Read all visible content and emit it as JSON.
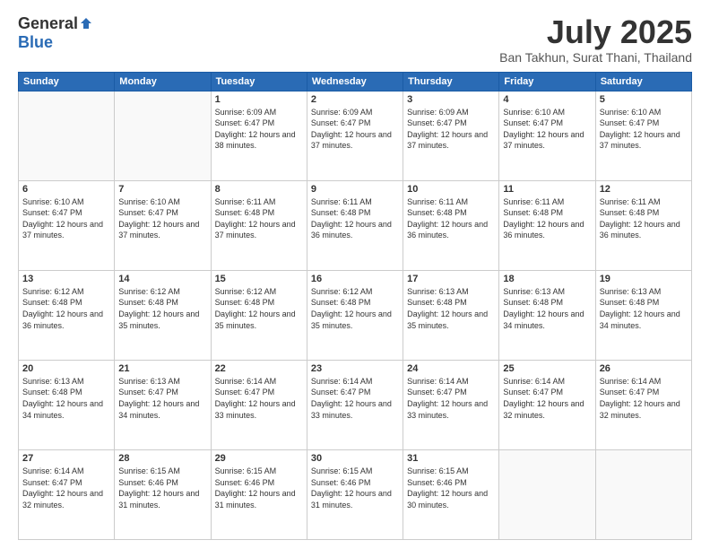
{
  "header": {
    "logo_general": "General",
    "logo_blue": "Blue",
    "month_title": "July 2025",
    "subtitle": "Ban Takhun, Surat Thani, Thailand"
  },
  "weekdays": [
    "Sunday",
    "Monday",
    "Tuesday",
    "Wednesday",
    "Thursday",
    "Friday",
    "Saturday"
  ],
  "weeks": [
    [
      {
        "day": "",
        "sunrise": "",
        "sunset": "",
        "daylight": ""
      },
      {
        "day": "",
        "sunrise": "",
        "sunset": "",
        "daylight": ""
      },
      {
        "day": "1",
        "sunrise": "Sunrise: 6:09 AM",
        "sunset": "Sunset: 6:47 PM",
        "daylight": "Daylight: 12 hours and 38 minutes."
      },
      {
        "day": "2",
        "sunrise": "Sunrise: 6:09 AM",
        "sunset": "Sunset: 6:47 PM",
        "daylight": "Daylight: 12 hours and 37 minutes."
      },
      {
        "day": "3",
        "sunrise": "Sunrise: 6:09 AM",
        "sunset": "Sunset: 6:47 PM",
        "daylight": "Daylight: 12 hours and 37 minutes."
      },
      {
        "day": "4",
        "sunrise": "Sunrise: 6:10 AM",
        "sunset": "Sunset: 6:47 PM",
        "daylight": "Daylight: 12 hours and 37 minutes."
      },
      {
        "day": "5",
        "sunrise": "Sunrise: 6:10 AM",
        "sunset": "Sunset: 6:47 PM",
        "daylight": "Daylight: 12 hours and 37 minutes."
      }
    ],
    [
      {
        "day": "6",
        "sunrise": "Sunrise: 6:10 AM",
        "sunset": "Sunset: 6:47 PM",
        "daylight": "Daylight: 12 hours and 37 minutes."
      },
      {
        "day": "7",
        "sunrise": "Sunrise: 6:10 AM",
        "sunset": "Sunset: 6:47 PM",
        "daylight": "Daylight: 12 hours and 37 minutes."
      },
      {
        "day": "8",
        "sunrise": "Sunrise: 6:11 AM",
        "sunset": "Sunset: 6:48 PM",
        "daylight": "Daylight: 12 hours and 37 minutes."
      },
      {
        "day": "9",
        "sunrise": "Sunrise: 6:11 AM",
        "sunset": "Sunset: 6:48 PM",
        "daylight": "Daylight: 12 hours and 36 minutes."
      },
      {
        "day": "10",
        "sunrise": "Sunrise: 6:11 AM",
        "sunset": "Sunset: 6:48 PM",
        "daylight": "Daylight: 12 hours and 36 minutes."
      },
      {
        "day": "11",
        "sunrise": "Sunrise: 6:11 AM",
        "sunset": "Sunset: 6:48 PM",
        "daylight": "Daylight: 12 hours and 36 minutes."
      },
      {
        "day": "12",
        "sunrise": "Sunrise: 6:11 AM",
        "sunset": "Sunset: 6:48 PM",
        "daylight": "Daylight: 12 hours and 36 minutes."
      }
    ],
    [
      {
        "day": "13",
        "sunrise": "Sunrise: 6:12 AM",
        "sunset": "Sunset: 6:48 PM",
        "daylight": "Daylight: 12 hours and 36 minutes."
      },
      {
        "day": "14",
        "sunrise": "Sunrise: 6:12 AM",
        "sunset": "Sunset: 6:48 PM",
        "daylight": "Daylight: 12 hours and 35 minutes."
      },
      {
        "day": "15",
        "sunrise": "Sunrise: 6:12 AM",
        "sunset": "Sunset: 6:48 PM",
        "daylight": "Daylight: 12 hours and 35 minutes."
      },
      {
        "day": "16",
        "sunrise": "Sunrise: 6:12 AM",
        "sunset": "Sunset: 6:48 PM",
        "daylight": "Daylight: 12 hours and 35 minutes."
      },
      {
        "day": "17",
        "sunrise": "Sunrise: 6:13 AM",
        "sunset": "Sunset: 6:48 PM",
        "daylight": "Daylight: 12 hours and 35 minutes."
      },
      {
        "day": "18",
        "sunrise": "Sunrise: 6:13 AM",
        "sunset": "Sunset: 6:48 PM",
        "daylight": "Daylight: 12 hours and 34 minutes."
      },
      {
        "day": "19",
        "sunrise": "Sunrise: 6:13 AM",
        "sunset": "Sunset: 6:48 PM",
        "daylight": "Daylight: 12 hours and 34 minutes."
      }
    ],
    [
      {
        "day": "20",
        "sunrise": "Sunrise: 6:13 AM",
        "sunset": "Sunset: 6:48 PM",
        "daylight": "Daylight: 12 hours and 34 minutes."
      },
      {
        "day": "21",
        "sunrise": "Sunrise: 6:13 AM",
        "sunset": "Sunset: 6:47 PM",
        "daylight": "Daylight: 12 hours and 34 minutes."
      },
      {
        "day": "22",
        "sunrise": "Sunrise: 6:14 AM",
        "sunset": "Sunset: 6:47 PM",
        "daylight": "Daylight: 12 hours and 33 minutes."
      },
      {
        "day": "23",
        "sunrise": "Sunrise: 6:14 AM",
        "sunset": "Sunset: 6:47 PM",
        "daylight": "Daylight: 12 hours and 33 minutes."
      },
      {
        "day": "24",
        "sunrise": "Sunrise: 6:14 AM",
        "sunset": "Sunset: 6:47 PM",
        "daylight": "Daylight: 12 hours and 33 minutes."
      },
      {
        "day": "25",
        "sunrise": "Sunrise: 6:14 AM",
        "sunset": "Sunset: 6:47 PM",
        "daylight": "Daylight: 12 hours and 32 minutes."
      },
      {
        "day": "26",
        "sunrise": "Sunrise: 6:14 AM",
        "sunset": "Sunset: 6:47 PM",
        "daylight": "Daylight: 12 hours and 32 minutes."
      }
    ],
    [
      {
        "day": "27",
        "sunrise": "Sunrise: 6:14 AM",
        "sunset": "Sunset: 6:47 PM",
        "daylight": "Daylight: 12 hours and 32 minutes."
      },
      {
        "day": "28",
        "sunrise": "Sunrise: 6:15 AM",
        "sunset": "Sunset: 6:46 PM",
        "daylight": "Daylight: 12 hours and 31 minutes."
      },
      {
        "day": "29",
        "sunrise": "Sunrise: 6:15 AM",
        "sunset": "Sunset: 6:46 PM",
        "daylight": "Daylight: 12 hours and 31 minutes."
      },
      {
        "day": "30",
        "sunrise": "Sunrise: 6:15 AM",
        "sunset": "Sunset: 6:46 PM",
        "daylight": "Daylight: 12 hours and 31 minutes."
      },
      {
        "day": "31",
        "sunrise": "Sunrise: 6:15 AM",
        "sunset": "Sunset: 6:46 PM",
        "daylight": "Daylight: 12 hours and 30 minutes."
      },
      {
        "day": "",
        "sunrise": "",
        "sunset": "",
        "daylight": ""
      },
      {
        "day": "",
        "sunrise": "",
        "sunset": "",
        "daylight": ""
      }
    ]
  ]
}
